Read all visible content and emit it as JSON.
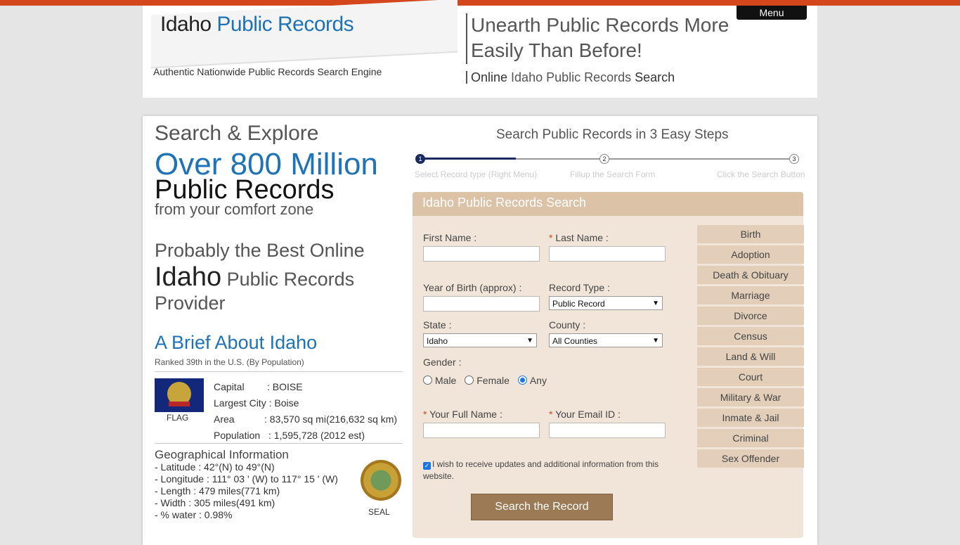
{
  "header": {
    "logo_plain": "Idaho ",
    "logo_highlight": "Public Records",
    "tagline": "Authentic Nationwide Public Records Search Engine",
    "headline": "Unearth Public Records More Easily Than Before!",
    "sub_a": "Online ",
    "sub_b": "Idaho Public Records",
    "sub_c": " Search",
    "menu_label": "Menu"
  },
  "left": {
    "search_explore": "Search & Explore",
    "over": "Over 800 Million",
    "public_records": "Public Records",
    "comfort": "from your comfort zone",
    "prob_line1": "Probably the Best Online",
    "prob_state": "Idaho",
    "prob_rest": " Public Records",
    "prob_line3": "Provider",
    "brief_title": "A Brief About Idaho",
    "ranked": "Ranked 39th in the U.S. (By Population)",
    "flag_label": "FLAG",
    "facts": [
      {
        "k": "Capital",
        "v": ": BOISE"
      },
      {
        "k": "Largest City",
        "v": ": Boise"
      },
      {
        "k": "Area",
        "v": ": 83,570 sq mi(216,632 sq km)"
      },
      {
        "k": "Population",
        "v": ": 1,595,728 (2012 est)"
      }
    ],
    "geo_title": "Geographical Information",
    "geo": [
      "- Latitude : 42°(N) to 49°(N)",
      "- Longitude : 111° 03 ' (W) to 117° 15 ' (W)",
      "- Length : 479 miles(771 km)",
      "- Width : 305 miles(491 km)",
      "- % water : 0.98%"
    ],
    "seal_label": "SEAL"
  },
  "steps": {
    "title": "Search Public Records in 3 Easy Steps",
    "dots": [
      "1",
      "2",
      "3"
    ],
    "labels": [
      "Select Record type (Right Menu)",
      "Fillup the Search Form",
      "Click the Search Button"
    ],
    "progress": 0.26
  },
  "form": {
    "title": "Idaho Public Records Search",
    "first_name_label": "First Name :",
    "last_name_label": " Last Name :",
    "req_mark": "*",
    "yob_label": "Year of Birth (approx) :",
    "record_type_label": "Record Type :",
    "record_type_value": "Public Record",
    "state_label": "State :",
    "state_value": "Idaho",
    "county_label": "County :",
    "county_value": "All Counties",
    "gender_label": "Gender :",
    "gender_options": [
      "Male",
      "Female",
      "Any"
    ],
    "gender_selected": "Any",
    "full_name_label": " Your Full Name :",
    "email_label": " Your Email ID :",
    "consent_text": "I wish to receive updates and additional information from this website.",
    "consent_checked": true,
    "submit_label": "Search the Record"
  },
  "record_types": [
    "Birth",
    "Adoption",
    "Death & Obituary",
    "Marriage",
    "Divorce",
    "Census",
    "Land & Will",
    "Court",
    "Military & War",
    "Inmate & Jail",
    "Criminal",
    "Sex Offender"
  ],
  "colors": {
    "accent_bar": "#d4471d",
    "brand_blue": "#1e73b8",
    "panel_bg": "#f1e5da",
    "button_brown": "#9c7a56"
  }
}
